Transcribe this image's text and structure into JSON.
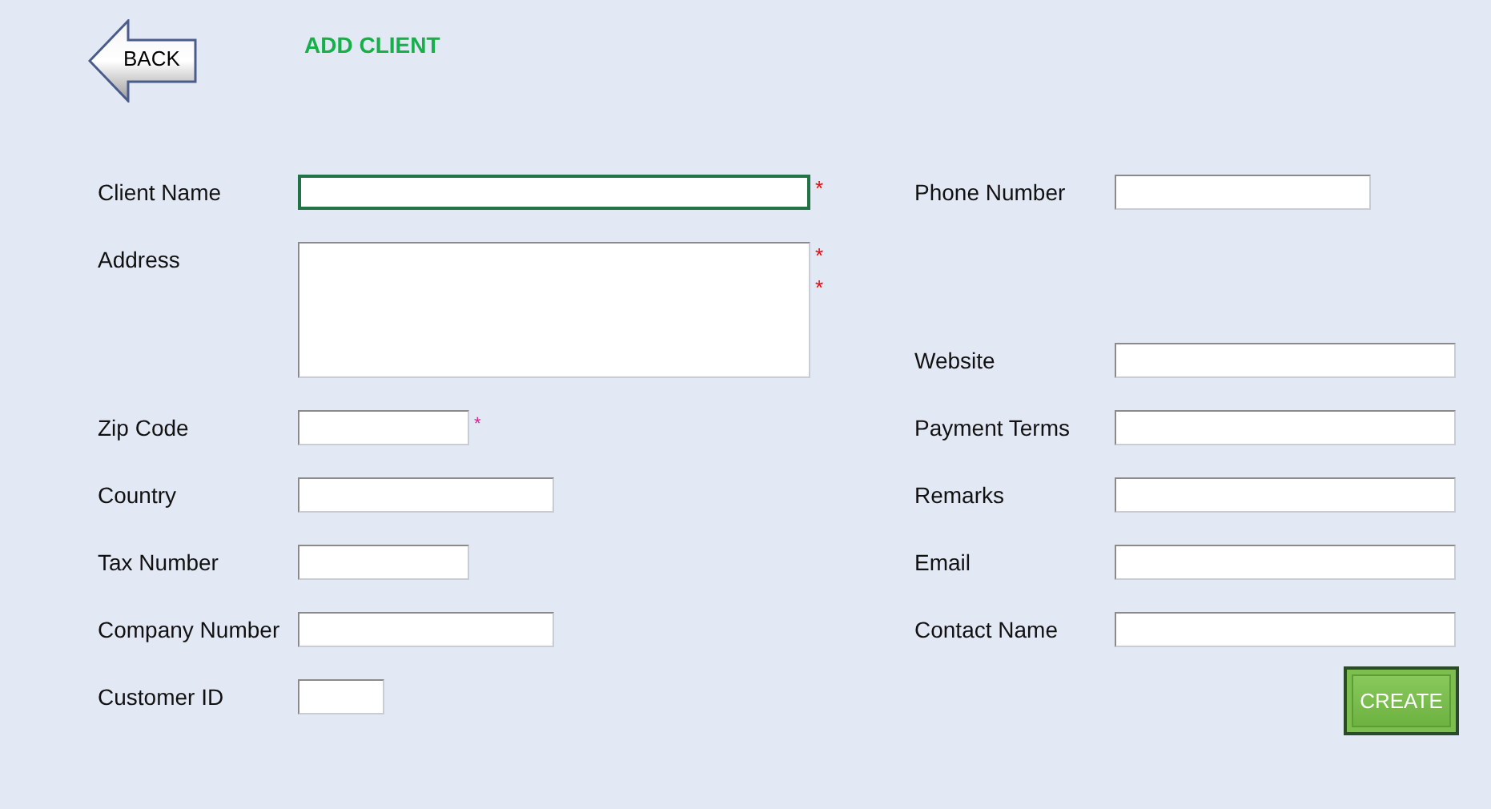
{
  "back_button": {
    "label": "BACK"
  },
  "title": "ADD CLIENT",
  "rows": [
    {
      "left": {
        "label": "Client Name",
        "kind": "single",
        "focused": true,
        "required_marks": [
          "*"
        ]
      },
      "right": {
        "label": "Phone Number",
        "kind": "single",
        "focused": false
      }
    },
    {
      "left": {
        "label": "Address",
        "kind": "multi",
        "focused": false,
        "required_marks": [
          "*",
          "*"
        ]
      },
      "right": {
        "label": "Website",
        "kind": "single",
        "focused": false
      }
    },
    {
      "left": {
        "label": "Zip Code",
        "kind": "single",
        "focused": false,
        "required_marks": [
          "*"
        ]
      },
      "right": {
        "label": "Payment Terms",
        "kind": "single",
        "focused": false
      }
    },
    {
      "left": {
        "label": "Country",
        "kind": "single",
        "focused": false
      },
      "right": {
        "label": "Remarks",
        "kind": "single",
        "focused": false
      }
    },
    {
      "left": {
        "label": "Tax Number",
        "kind": "single",
        "focused": false
      },
      "right": {
        "label": "Email",
        "kind": "single",
        "focused": false
      }
    },
    {
      "left": {
        "label": "Company Number",
        "kind": "single",
        "focused": false
      },
      "right": {
        "label": "Contact Name",
        "kind": "single",
        "focused": false
      }
    },
    {
      "left": {
        "label": "Customer ID",
        "kind": "single",
        "focused": false
      }
    }
  ],
  "create_button": {
    "label": "CREATE"
  }
}
